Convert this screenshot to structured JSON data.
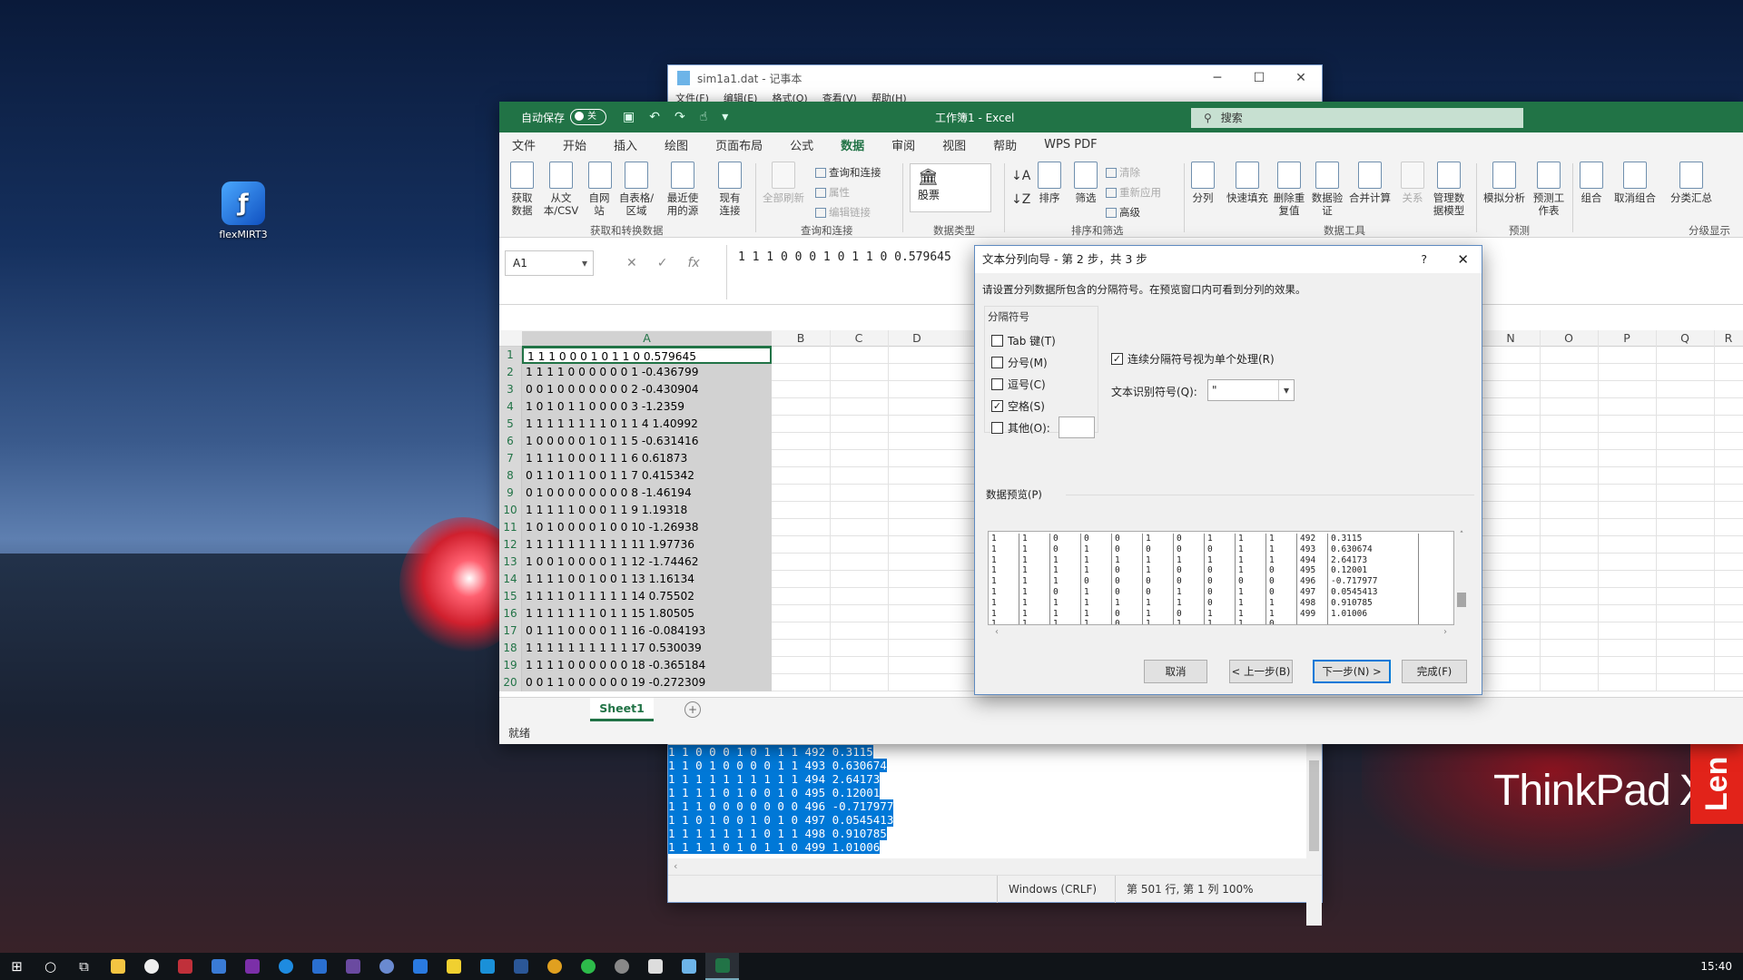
{
  "desktop": {
    "icon_label": "flexMIRT3",
    "brand": "ThinkPad",
    "brand_model": "X1",
    "lenovo": "Len"
  },
  "notepad": {
    "title": "sim1a1.dat - 记事本",
    "menu": [
      "文件(F)",
      "编辑(E)",
      "格式(O)",
      "查看(V)",
      "帮助(H)"
    ],
    "lines": [
      "1 1 0 0 0 1 0 1 1 1 492 0.3115",
      "1 1 0 1 0 0 0 0 1 1 493 0.630674",
      "1 1 1 1 1 1 1 1 1 1 494 2.64173",
      "1 1 1 1 0 1 0 0 1 0 495 0.12001",
      "1 1 1 0 0 0 0 0 0 0 496 -0.717977",
      "1 1 0 1 0 0 1 0 1 0 497 0.0545413",
      "1 1 1 1 1 1 1 0 1 1 498 0.910785",
      "1 1 1 1 0 1 0 1 1 0 499 1.01006"
    ],
    "status_eol": "Windows (CRLF)",
    "status_pos": "第 501 行, 第 1 列 100%"
  },
  "excel": {
    "autosave": "自动保存",
    "autosave_state": "关",
    "doc_title": "工作簿1 - Excel",
    "search": "搜索",
    "tabs": [
      "文件",
      "开始",
      "插入",
      "绘图",
      "页面布局",
      "公式",
      "数据",
      "审阅",
      "视图",
      "帮助",
      "WPS PDF"
    ],
    "ribbon": {
      "get_data": "获取数据",
      "from_text": "从文本/CSV",
      "from_web": "自网站",
      "from_table": "自表格/区域",
      "recent": "最近使用的源",
      "existing": "现有连接",
      "refresh_all": "全部刷新",
      "queries": "查询和连接",
      "properties": "属性",
      "edit_links": "编辑链接",
      "stock": "股票",
      "sort": "排序",
      "filter": "筛选",
      "clear": "清除",
      "reapply": "重新应用",
      "advanced": "高级",
      "split": "分列",
      "flash_fill": "快速填充",
      "remove_dup": "删除重复值",
      "validation": "数据验证",
      "consolidate": "合并计算",
      "relations": "关系",
      "data_model": "管理数据模型",
      "whatif": "模拟分析",
      "forecast": "预测工作表",
      "group": "组合",
      "ungroup": "取消组合",
      "subtotal": "分类汇总",
      "grp_get": "获取和转换数据",
      "grp_query": "查询和连接",
      "grp_types": "数据类型",
      "grp_sort": "排序和筛选",
      "grp_tools": "数据工具",
      "grp_forecast": "预测",
      "grp_outline": "分级显示"
    },
    "namebox": "A1",
    "formula": "1 1 1 0 0 0 1 0 1 1 0 0.579645",
    "columns": [
      "A",
      "B",
      "C",
      "D",
      "N",
      "O",
      "P",
      "Q",
      "R"
    ],
    "rows": [
      "1 1 1 0 0 0 1 0 1 1 0 0.579645",
      "1 1 1 1 0 0 0 0 0 0 1 -0.436799",
      "0 0 1 0 0 0 0 0 0 0 2 -0.430904",
      "1 0 1 0 1 1 0 0 0 0 3 -1.2359",
      "1 1 1 1 1 1 1 1 0 1 1 4 1.40992",
      "1 0 0 0 0 0 1 0 1 1 5 -0.631416",
      "1 1 1 1 0 0 0 1 1 1 6 0.61873",
      "0 1 1 0 1 1 0 0 1 1 7 0.415342",
      "0 1 0 0 0 0 0 0 0 0 8 -1.46194",
      "1 1 1 1 1 0 0 0 1 1 9 1.19318",
      "1 0 1 0 0 0 0 1 0 0 10 -1.26938",
      "1 1 1 1 1 1 1 1 1 1 11 1.97736",
      "1 0 0 1 0 0 0 0 1 1 12 -1.74462",
      "1 1 1 1 0 0 1 0 0 1 13 1.16134",
      "1 1 1 1 0 1 1 1 1 1 14 0.75502",
      "1 1 1 1 1 1 1 0 1 1 15 1.80505",
      "0 1 1 1 0 0 0 0 1 1 16 -0.084193",
      "1 1 1 1 1 1 1 1 1 1 17 0.530039",
      "1 1 1 1 0 0 0 0 0 0 18 -0.365184",
      "0 0 1 1 0 0 0 0 0 0 19 -0.272309"
    ],
    "sheet": "Sheet1",
    "status": "就绪"
  },
  "dialog": {
    "title": "文本分列向导 - 第 2 步，共 3 步",
    "help": "?",
    "description": "请设置分列数据所包含的分隔符号。在预览窗口内可看到分列的效果。",
    "delimiters_label": "分隔符号",
    "tab": "Tab 键(T)",
    "tab_checked": false,
    "semicolon": "分号(M)",
    "semicolon_checked": false,
    "comma": "逗号(C)",
    "comma_checked": false,
    "space": "空格(S)",
    "space_checked": true,
    "other": "其他(O):",
    "other_checked": false,
    "consecutive": "连续分隔符号视为单个处理(R)",
    "consecutive_checked": true,
    "qualifier_label": "文本识别符号(Q):",
    "qualifier_value": "\"",
    "preview_label": "数据预览(P)",
    "preview_columns": [
      [
        "1",
        "1",
        "1",
        "1",
        "1",
        "1",
        "1",
        "1",
        "1"
      ],
      [
        "1",
        "1",
        "1",
        "1",
        "1",
        "1",
        "1",
        "1",
        "1"
      ],
      [
        "0",
        "0",
        "1",
        "1",
        "1",
        "0",
        "1",
        "1",
        "1"
      ],
      [
        "0",
        "1",
        "1",
        "1",
        "0",
        "1",
        "1",
        "1",
        "1"
      ],
      [
        "0",
        "0",
        "1",
        "0",
        "0",
        "0",
        "1",
        "0",
        "0"
      ],
      [
        "1",
        "0",
        "1",
        "1",
        "0",
        "0",
        "1",
        "1",
        "1"
      ],
      [
        "0",
        "0",
        "1",
        "0",
        "0",
        "1",
        "1",
        "0",
        "1"
      ],
      [
        "1",
        "0",
        "1",
        "0",
        "0",
        "0",
        "0",
        "1",
        "1"
      ],
      [
        "1",
        "1",
        "1",
        "1",
        "0",
        "1",
        "1",
        "1",
        "1"
      ],
      [
        "1",
        "1",
        "1",
        "0",
        "0",
        "0",
        "1",
        "1",
        "0"
      ],
      [
        "492",
        "493",
        "494",
        "495",
        "496",
        "497",
        "498",
        "499",
        ""
      ],
      [
        "0.3115",
        "0.630674",
        "2.64173",
        "0.12001",
        "-0.717977",
        "0.0545413",
        "0.910785",
        "1.01006",
        ""
      ]
    ],
    "cancel": "取消",
    "back": "< 上一步(B)",
    "next": "下一步(N) >",
    "finish": "完成(F)"
  },
  "taskbar": {
    "clock": "15:40"
  }
}
